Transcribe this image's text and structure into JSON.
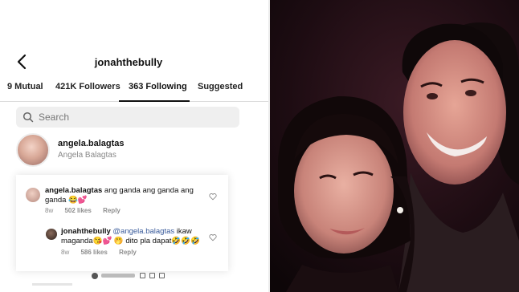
{
  "header": {
    "title": "jonahthebully"
  },
  "tabs": [
    {
      "label": "9 Mutual",
      "active": false
    },
    {
      "label": "421K Followers",
      "active": false
    },
    {
      "label": "363 Following",
      "active": true
    },
    {
      "label": "Suggested",
      "active": false
    }
  ],
  "search": {
    "placeholder": "Search"
  },
  "user": {
    "handle": "angela.balagtas",
    "full_name": "Angela Balagtas"
  },
  "comments": [
    {
      "author": "angela.balagtas",
      "text": "ang ganda ang ganda ang ganda 😂💕",
      "time": "8w",
      "likes": "502 likes",
      "reply": "Reply"
    },
    {
      "author": "jonahthebully",
      "mention": "@angela.balagtas",
      "text": "ikaw maganda😘💕 🤭 dito pla dapat🤣🤣🤣",
      "time": "8w",
      "likes": "586 likes",
      "reply": "Reply"
    }
  ],
  "colors": {
    "mention": "#365899",
    "meta": "#8e8e8e",
    "photo_bg": "#160b10"
  }
}
